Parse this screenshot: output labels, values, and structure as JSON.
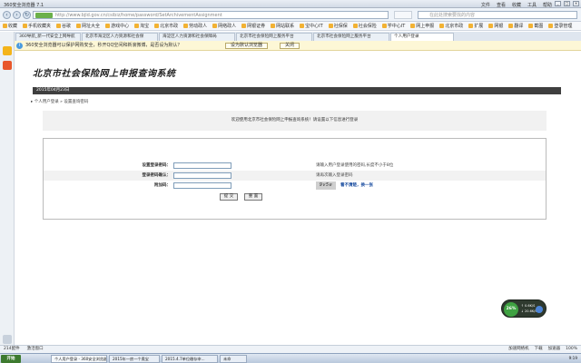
{
  "browser": {
    "title": "360安全浏览器 7.1",
    "menu": [
      "文件",
      "查看",
      "收藏",
      "工具",
      "帮助"
    ],
    "url": "http://www.bjld.gov.cn/csibiz/home/password/SetArchivementAssignment",
    "search_placeholder": "在此处搜索要找的内容"
  },
  "favorites": [
    "收藏",
    "手机收藏夹",
    "谷歌",
    "网址大全",
    "游戏中心",
    "淘宝",
    "北京市政",
    "劳动政人",
    "网络政人",
    "网银证券",
    "网站联系",
    "宝中心IT",
    "社保保",
    "社会保险",
    "学中心IT",
    "网上申报",
    "北京市政",
    "扩展",
    "网银",
    "翻译",
    "截图",
    "登录管理"
  ],
  "tabs": [
    {
      "label": "360导航_新一代安全上网导航",
      "active": false
    },
    {
      "label": "北京市海淀区人力资源和社会保",
      "active": false
    },
    {
      "label": "海淀区人力资源和社会保障局",
      "active": false
    },
    {
      "label": "北京市社会保险网上服务平台",
      "active": false
    },
    {
      "label": "北京市社会保险网上服务平台",
      "active": false
    },
    {
      "label": "个人用户登录",
      "active": true
    }
  ],
  "infobar": {
    "text": "360安全浏览器可以保护网购安全，秒开QQ空间和新浪微博，是否设为默认？",
    "set_default": "设为默认浏览器",
    "close": "关闭"
  },
  "page": {
    "logo": "北京市社会保险网上申报查询系统",
    "date": "2015年04月23日",
    "breadcrumb": "个人用户登录 » 设置查询密码",
    "welcome": "欢迎使用北京市社会保险网上申报查询系统！请设置以下信息进行登录",
    "fields": [
      {
        "label": "设置登录密码：",
        "hint": "请输入用户登录使用的密码,长度不小于8位"
      },
      {
        "label": "登录密码确认：",
        "hint": "请再次输入登录密码"
      },
      {
        "label": "附加码：",
        "hint": ""
      }
    ],
    "captcha_text": "9v5e",
    "refresh_link": "看不清楚，换一张",
    "submit": "提 交",
    "reset": "重 置"
  },
  "speed_widget": {
    "percent": "26%",
    "up": "↑ 0.6K/S",
    "down": "↓ 20.6K/S"
  },
  "statusbar": {
    "left": [
      "214配件",
      "激活窗口"
    ],
    "right": [
      "加速网络机",
      "下载",
      "加速器",
      "100%"
    ]
  },
  "taskbar": {
    "start": "开始",
    "items": [
      {
        "label": "个人用户登录 - 360安全浏览器",
        "active": true
      },
      {
        "label": "2015年一房一个奥宝",
        "active": false
      },
      {
        "label": "2015.4.7单位缴存申...",
        "active": false
      },
      {
        "label": "未命",
        "active": false
      }
    ],
    "clock": "9:19"
  }
}
